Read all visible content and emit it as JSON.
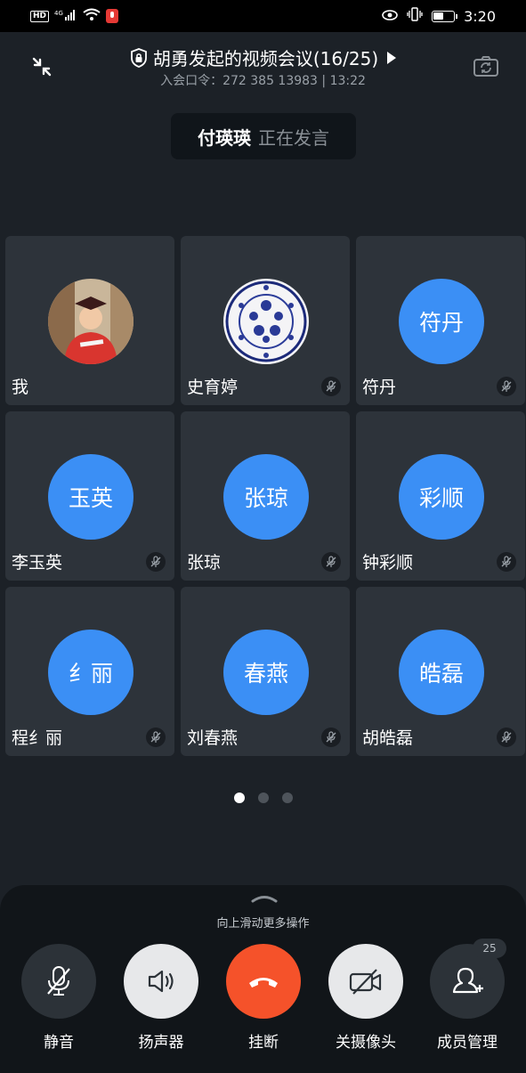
{
  "status_bar": {
    "hd": "HD",
    "network": "4G",
    "time": "3:20"
  },
  "header": {
    "title": "胡勇发起的视频会议(16/25)",
    "subtitle": "入会口令：272 385 13983 | 13:22"
  },
  "speaking": {
    "name": "付瑛瑛",
    "status": "正在发言"
  },
  "participants": [
    {
      "name": "我",
      "avatar_text": "",
      "avatar_type": "photo-graduate",
      "muted": false
    },
    {
      "name": "史育婷",
      "avatar_text": "",
      "avatar_type": "photo-porcelain",
      "muted": true
    },
    {
      "name": "符丹",
      "avatar_text": "符丹",
      "avatar_type": "text",
      "muted": true
    },
    {
      "name": "李玉英",
      "avatar_text": "玉英",
      "avatar_type": "text",
      "muted": true
    },
    {
      "name": "张琼",
      "avatar_text": "张琼",
      "avatar_type": "text",
      "muted": true
    },
    {
      "name": "钟彩顺",
      "avatar_text": "彩顺",
      "avatar_type": "text",
      "muted": true
    },
    {
      "name": "程纟丽",
      "avatar_text": "纟丽",
      "avatar_type": "text",
      "muted": true
    },
    {
      "name": "刘春燕",
      "avatar_text": "春燕",
      "avatar_type": "text",
      "muted": true
    },
    {
      "name": "胡皓磊",
      "avatar_text": "皓磊",
      "avatar_type": "text",
      "muted": true
    }
  ],
  "pager": {
    "pages": 3,
    "current": 1
  },
  "bottom": {
    "hint": "向上滑动更多操作",
    "actions": [
      {
        "label": "静音",
        "icon": "mic-off-icon"
      },
      {
        "label": "扬声器",
        "icon": "speaker-icon"
      },
      {
        "label": "挂断",
        "icon": "hangup-icon"
      },
      {
        "label": "关摄像头",
        "icon": "camera-off-icon"
      },
      {
        "label": "成员管理",
        "icon": "add-member-icon"
      }
    ],
    "member_count": "25"
  },
  "colors": {
    "accent": "#3b8ff5",
    "hangup": "#f5522a",
    "background": "#1c2127",
    "tile": "#2d333a"
  }
}
